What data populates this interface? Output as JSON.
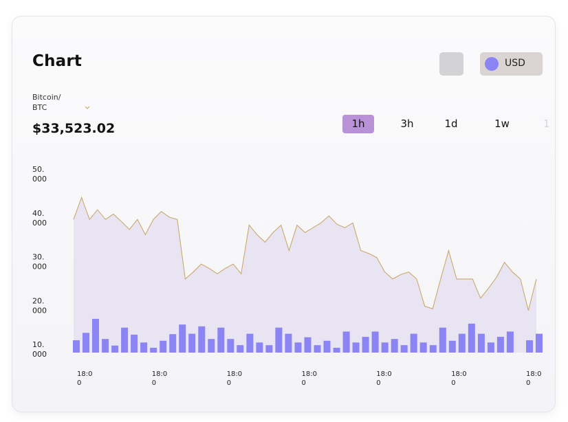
{
  "header": {
    "title": "Chart",
    "currency": "USD"
  },
  "pair": {
    "label_line1": "Bitcoin/",
    "label_line2": "BTC",
    "price": "$33,523.02"
  },
  "tabs": [
    "1h",
    "3h",
    "1d",
    "1w"
  ],
  "active_tab": "1h",
  "partial_tab": "1",
  "colors": {
    "line": "#c9a96c",
    "area": "#e9e4f1",
    "bars": "#8a84f4",
    "active_tab": "#b891d6",
    "currency_dot": "#8a84f4"
  },
  "chart_data": {
    "type": "line",
    "y_tick_labels": [
      [
        "50.",
        "000"
      ],
      [
        "40.",
        "000"
      ],
      [
        "30.",
        "000"
      ],
      [
        "20.",
        "000"
      ],
      [
        "10.",
        "000"
      ]
    ],
    "y_ticks": [
      50000,
      40000,
      30000,
      20000,
      10000
    ],
    "ylim": [
      10000,
      50000
    ],
    "x_tick_labels": [
      [
        "18:0",
        "0"
      ],
      [
        "18:0",
        "0"
      ],
      [
        "18:0",
        "0"
      ],
      [
        "18:0",
        "0"
      ],
      [
        "18:0",
        "0"
      ],
      [
        "18:0",
        "0"
      ],
      [
        "18:0",
        "0"
      ]
    ],
    "series": [
      {
        "type": "area",
        "values": [
          40400,
          45400,
          40400,
          42600,
          40400,
          41600,
          39900,
          38100,
          40400,
          36900,
          40400,
          42200,
          40900,
          40400,
          26800,
          28400,
          30200,
          29200,
          28000,
          29200,
          30200,
          28000,
          39100,
          36900,
          35200,
          37400,
          39100,
          33300,
          39100,
          37400,
          38500,
          39600,
          41200,
          39300,
          38500,
          39600,
          33300,
          32600,
          31700,
          28400,
          26800,
          27800,
          28400,
          26800,
          20600,
          20000,
          26800,
          33300,
          26800,
          26800,
          26800,
          22400,
          24700,
          27200,
          30600,
          28400,
          26800,
          19600,
          26800
        ]
      },
      {
        "type": "bar",
        "values": [
          12800,
          14500,
          17700,
          13100,
          11600,
          15700,
          14100,
          12300,
          11100,
          12700,
          14200,
          16400,
          14300,
          16000,
          13100,
          15700,
          13100,
          11700,
          14300,
          12300,
          11700,
          15700,
          14300,
          12300,
          13500,
          11700,
          12700,
          11100,
          14800,
          12300,
          13600,
          14800,
          12300,
          13100,
          11700,
          14300,
          12300,
          11700,
          15700,
          12700,
          14300,
          16600,
          14300,
          12300,
          13600,
          14800,
          null,
          12800,
          14300
        ]
      }
    ]
  }
}
